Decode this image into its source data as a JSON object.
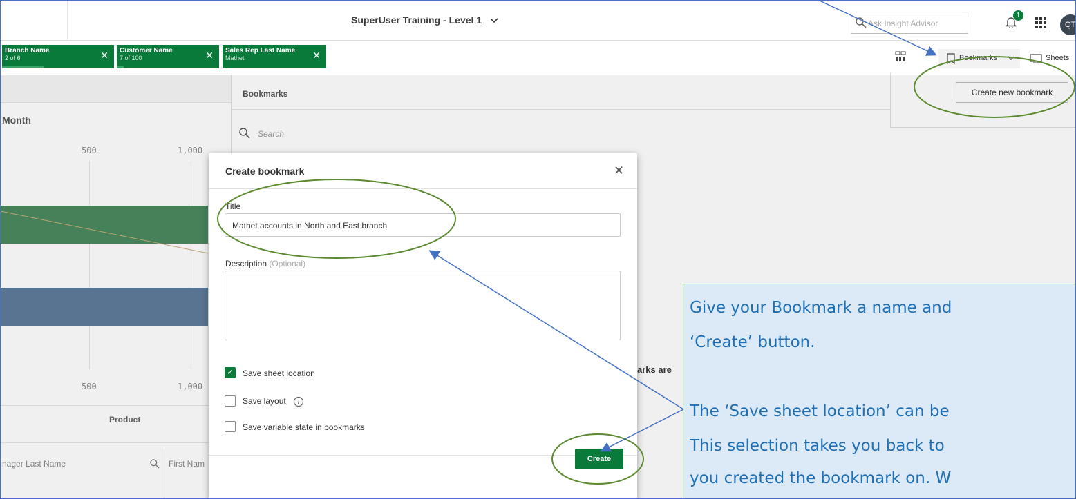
{
  "app": {
    "title": "SuperUser Training - Level 1"
  },
  "search": {
    "placeholder": "Ask Insight Advisor"
  },
  "notifications": {
    "count": "1"
  },
  "user": {
    "initials": "QT"
  },
  "selections": [
    {
      "field": "Branch Name",
      "state": "2 of 6"
    },
    {
      "field": "Customer Name",
      "state": "7 of 100"
    },
    {
      "field": "Sales Rep Last Name",
      "state": "Mathet"
    }
  ],
  "toolbar": {
    "bookmarks_label": "Bookmarks",
    "sheets_label": "Sheets",
    "create_new_bookmark": "Create new bookmark"
  },
  "sheet": {
    "chart_title": "Month",
    "ticks_top": [
      "500",
      "1,000"
    ],
    "ticks_bottom": [
      "500",
      "1,000"
    ],
    "product_header": "Product",
    "column1": "nager Last Name",
    "column2": "First Nam"
  },
  "bookmarks_panel": {
    "title": "Bookmarks",
    "search_placeholder": "Search",
    "wrap_text": "arks are"
  },
  "modal": {
    "title": "Create bookmark",
    "title_label": "Title",
    "title_value": "Mathet accounts in North and East branch",
    "description_label": "Description",
    "description_optional": "(Optional)",
    "save_sheet_location": "Save sheet location",
    "save_layout": "Save layout",
    "save_variable_state": "Save variable state in bookmarks",
    "create_button": "Create",
    "checks": {
      "sheet_location": true,
      "layout": false,
      "variable_state": false
    }
  },
  "callout": {
    "line1": "Give your Bookmark a name and",
    "line2": "‘Create’ button.",
    "line3": "The ‘Save sheet location’ can be",
    "line4": "This selection takes you back to",
    "line5": "you created the bookmark on.  W"
  },
  "colors": {
    "accent_green": "#0a7a3a",
    "callout_text": "#1f6fb5",
    "annotation_green": "#5b8a2f",
    "arrow_blue": "#4472c4"
  }
}
